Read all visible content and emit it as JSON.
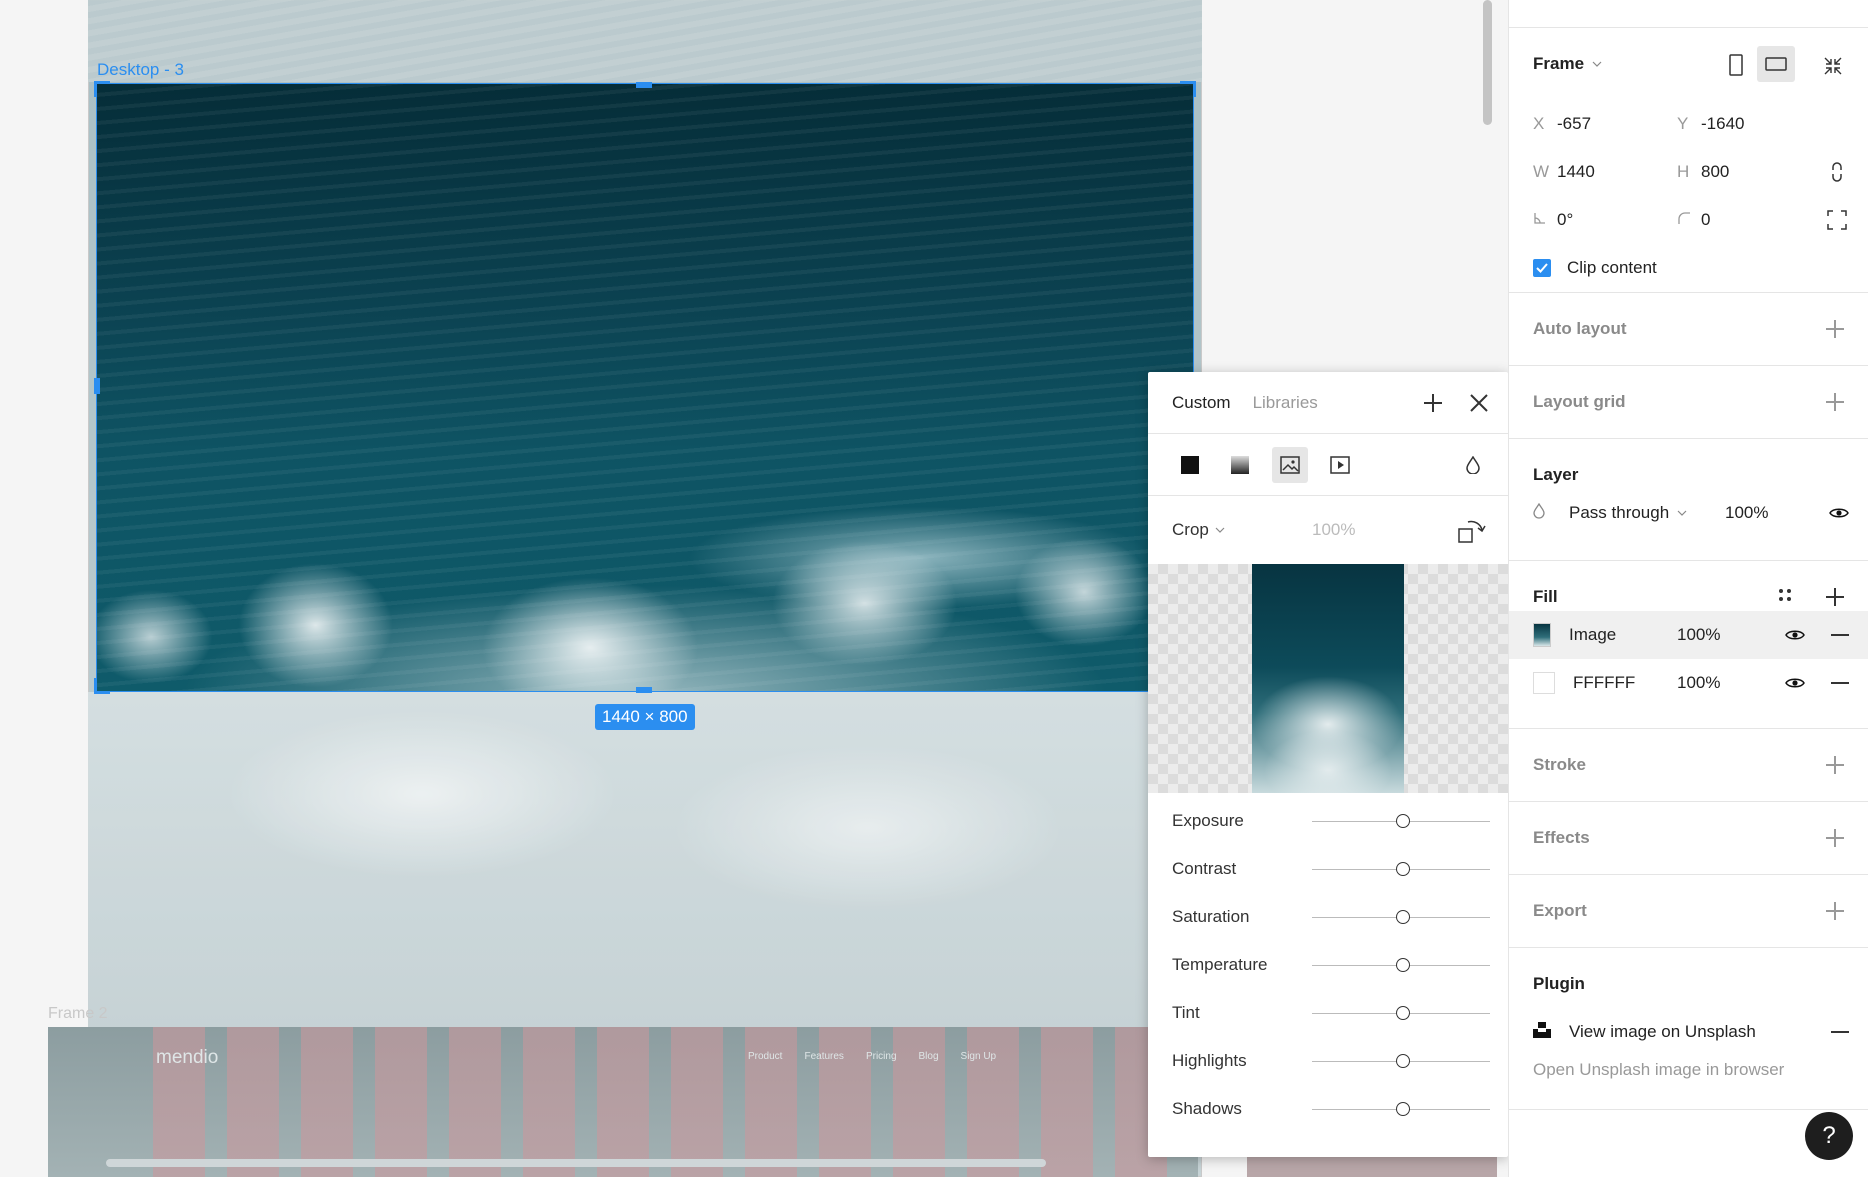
{
  "canvas": {
    "frame_label": "Desktop - 3",
    "size_badge": "1440 × 800",
    "frame2_label": "Frame 2",
    "frame2": {
      "logo": "mendio",
      "nav": [
        "Product",
        "Features",
        "Pricing",
        "Blog",
        "Sign Up"
      ]
    }
  },
  "popup": {
    "tabs": [
      "Custom",
      "Libraries"
    ],
    "fill_types": [
      "solid-icon",
      "gradient-icon",
      "image-icon",
      "video-icon"
    ],
    "crop_label": "Crop",
    "opacity": "100%",
    "adjustments": [
      "Exposure",
      "Contrast",
      "Saturation",
      "Temperature",
      "Tint",
      "Highlights",
      "Shadows"
    ]
  },
  "panel": {
    "frame": {
      "title": "Frame",
      "x_label": "X",
      "x": "-657",
      "y_label": "Y",
      "y": "-1640",
      "w_label": "W",
      "w": "1440",
      "h_label": "H",
      "h": "800",
      "rotation": "0°",
      "radius": "0",
      "clip_content": "Clip content"
    },
    "auto_layout": "Auto layout",
    "layout_grid": "Layout grid",
    "layer": {
      "title": "Layer",
      "blend": "Pass through",
      "opacity": "100%"
    },
    "fill": {
      "title": "Fill",
      "items": [
        {
          "name": "Image",
          "opacity": "100%"
        },
        {
          "name": "FFFFFF",
          "opacity": "100%"
        }
      ]
    },
    "stroke": "Stroke",
    "effects": "Effects",
    "export": "Export",
    "plugin": {
      "title": "Plugin",
      "action": "View image on Unsplash",
      "sub": "Open Unsplash image in browser"
    }
  },
  "help": "?"
}
